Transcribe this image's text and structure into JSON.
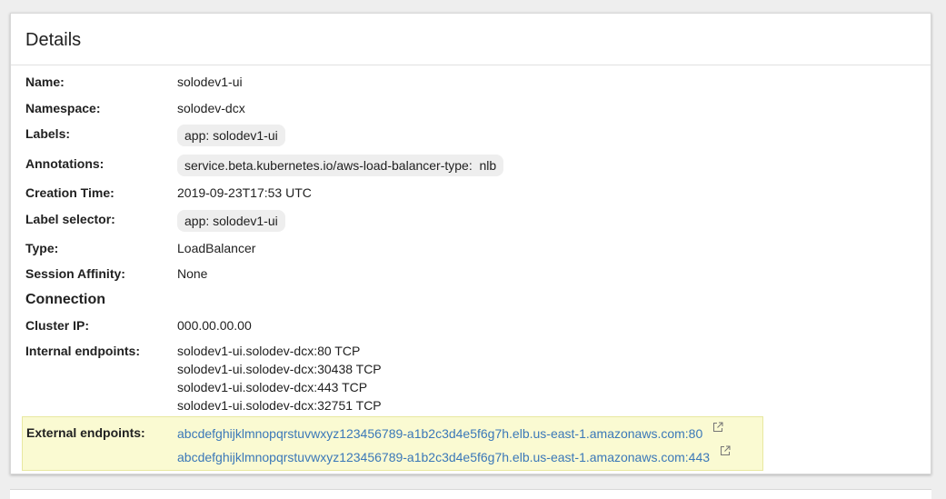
{
  "card": {
    "title": "Details"
  },
  "details": {
    "name_label": "Name:",
    "name_value": "solodev1-ui",
    "namespace_label": "Namespace:",
    "namespace_value": "solodev-dcx",
    "labels_label": "Labels:",
    "labels_chip": "app: solodev1-ui",
    "annotations_label": "Annotations:",
    "annotations_chip": "service.beta.kubernetes.io/aws-load-balancer-type:  nlb",
    "creation_label": "Creation Time:",
    "creation_value": "2019-09-23T17:53 UTC",
    "selector_label": "Label selector:",
    "selector_chip": "app: solodev1-ui",
    "type_label": "Type:",
    "type_value": "LoadBalancer",
    "affinity_label": "Session Affinity:",
    "affinity_value": "None"
  },
  "connection": {
    "title": "Connection",
    "cluster_ip_label": "Cluster IP:",
    "cluster_ip_value": "000.00.00.00",
    "internal_label": "Internal endpoints:",
    "internal_endpoints": [
      "solodev1-ui.solodev-dcx:80 TCP",
      "solodev1-ui.solodev-dcx:30438 TCP",
      "solodev1-ui.solodev-dcx:443 TCP",
      "solodev1-ui.solodev-dcx:32751 TCP"
    ],
    "external_label": "External endpoints:",
    "external_endpoints": [
      "abcdefghijklmnopqrstuvwxyz123456789-a1b2c3d4e5f6g7h.elb.us-east-1.amazonaws.com:80",
      "abcdefghijklmnopqrstuvwxyz123456789-a1b2c3d4e5f6g7h.elb.us-east-1.amazonaws.com:443"
    ]
  },
  "colors": {
    "link": "#3b78b8",
    "highlight": "#fafad2",
    "chip": "#eeeeee"
  },
  "icons": {
    "external": "open-in-new-icon"
  }
}
